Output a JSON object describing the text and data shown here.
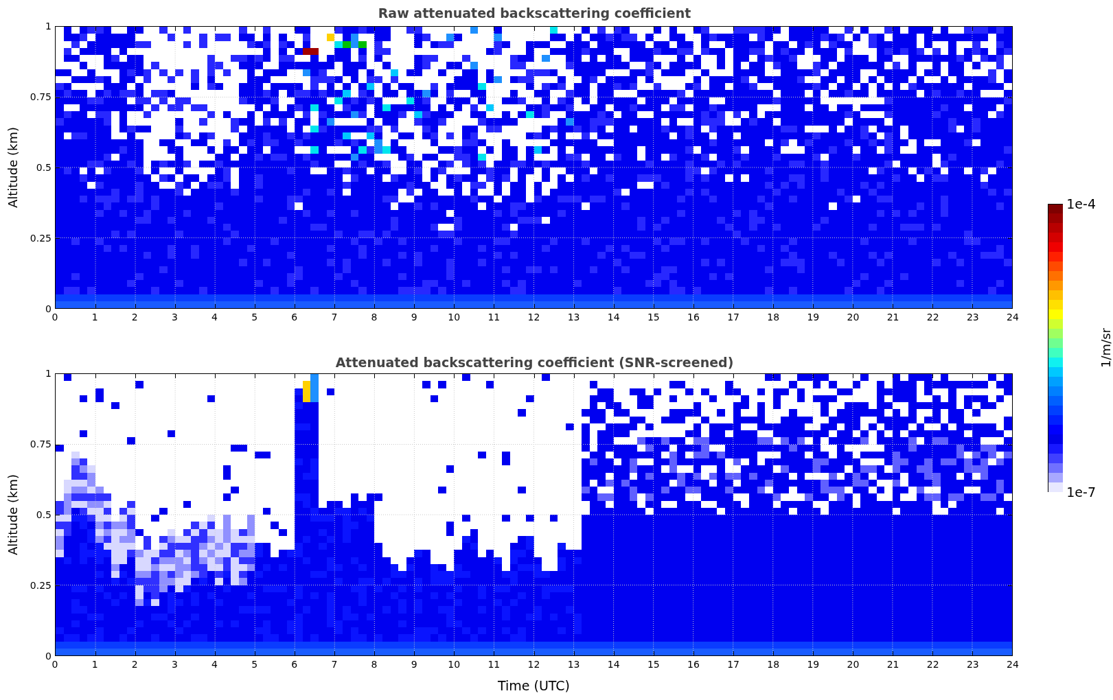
{
  "panels": [
    {
      "kind": "raw",
      "title": "Raw attenuated backscattering coefficient",
      "ylabel": "Altitude (km)",
      "yticks": [
        "1",
        "0.75",
        "0.5",
        "0.25",
        "0"
      ],
      "xticks": [
        "0",
        "1",
        "2",
        "3",
        "4",
        "5",
        "6",
        "7",
        "8",
        "9",
        "10",
        "11",
        "12",
        "13",
        "14",
        "15",
        "16",
        "17",
        "18",
        "19",
        "20",
        "21",
        "22",
        "23",
        "24"
      ]
    },
    {
      "kind": "screened",
      "title": "Attenuated backscattering coefficient (SNR-screened)",
      "ylabel": "Altitude (km)",
      "yticks": [
        "1",
        "0.75",
        "0.5",
        "0.25",
        "0"
      ],
      "xticks": [
        "0",
        "1",
        "2",
        "3",
        "4",
        "5",
        "6",
        "7",
        "8",
        "9",
        "10",
        "11",
        "12",
        "13",
        "14",
        "15",
        "16",
        "17",
        "18",
        "19",
        "20",
        "21",
        "22",
        "23",
        "24"
      ]
    }
  ],
  "xlabel": "Time (UTC)",
  "colorbar": {
    "max": "1e-4",
    "min": "1e-7",
    "label": "1/m/sr"
  }
}
